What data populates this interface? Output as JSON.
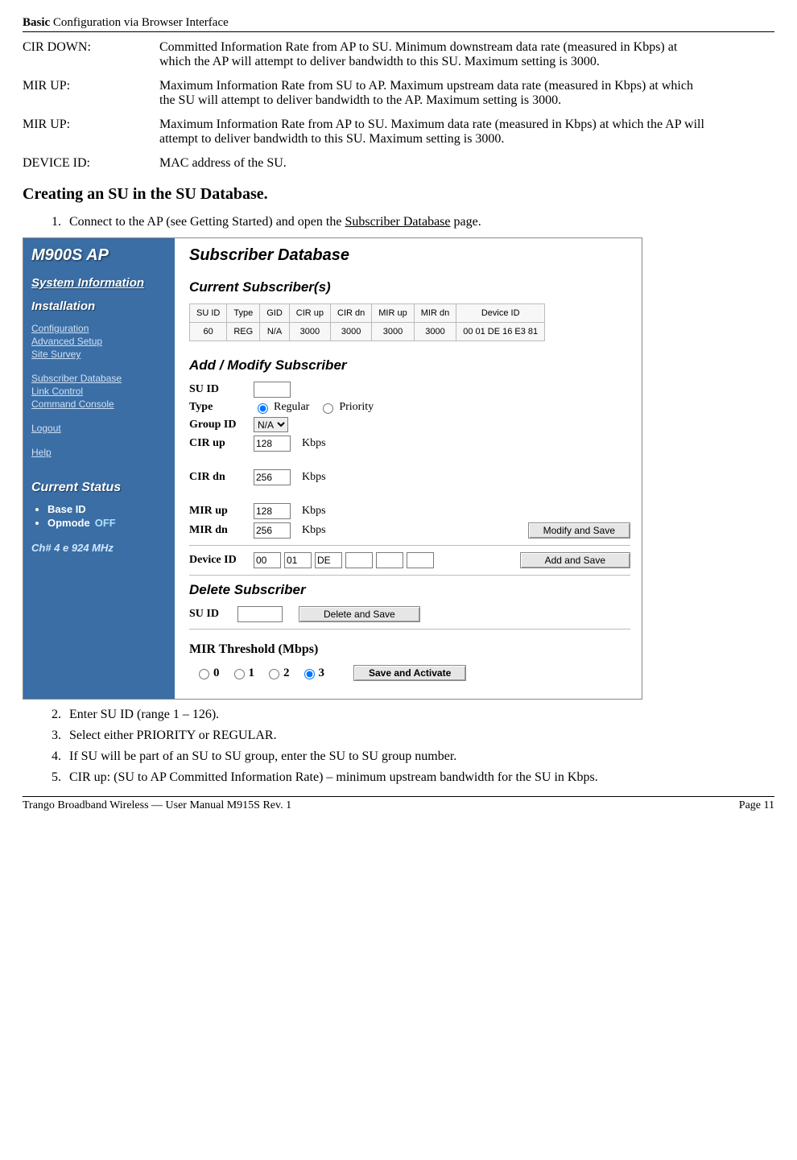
{
  "header": {
    "bold": "Basic",
    "rest": " Configuration via Browser Interface"
  },
  "defs": [
    {
      "term": "CIR DOWN:",
      "desc": "Committed Information Rate from AP to SU.  Minimum downstream data rate (measured in Kbps) at which the AP will attempt to deliver bandwidth to this SU.  Maximum setting is 3000."
    },
    {
      "term": "MIR UP:",
      "desc": "Maximum Information Rate from SU to AP.  Maximum upstream data rate (measured in Kbps) at which the SU will attempt to deliver bandwidth to the AP.  Maximum setting is 3000."
    },
    {
      "term": "MIR UP:",
      "desc": "Maximum Information Rate from AP to SU.  Maximum data rate (measured in Kbps) at which the AP will attempt to deliver bandwidth to this SU.  Maximum setting is 3000."
    },
    {
      "term": "DEVICE ID:",
      "desc": "MAC address of the SU."
    }
  ],
  "section_title": "Creating an SU in the SU Database.",
  "steps_top": [
    "Connect to the AP (see Getting Started) and open the "
  ],
  "step1_link": "Subscriber Database",
  "step1_tail": " page.",
  "sidebar": {
    "brand": "M900S AP",
    "sys_info": "System Information",
    "install": "Installation",
    "links1": [
      "Configuration",
      "Advanced Setup",
      "Site Survey"
    ],
    "links2": [
      "Subscriber Database",
      "Link Control",
      "Command Console"
    ],
    "logout": "Logout",
    "help": "Help",
    "status_title": "Current Status",
    "status_items": [
      {
        "label": "Base ID",
        "extra": ""
      },
      {
        "label": "Opmode",
        "extra": "OFF"
      }
    ],
    "chan": "Ch# 4 e 924 MHz"
  },
  "content": {
    "title": "Subscriber Database",
    "current_title": "Current Subscriber(s)",
    "table": {
      "headers": [
        "SU ID",
        "Type",
        "GID",
        "CIR up",
        "CIR dn",
        "MIR up",
        "MIR dn",
        "Device ID"
      ],
      "row": [
        "60",
        "REG",
        "N/A",
        "3000",
        "3000",
        "3000",
        "3000",
        "00 01 DE 16 E3 81"
      ]
    },
    "addmod_title": "Add / Modify Subscriber",
    "form": {
      "suid_label": "SU ID",
      "suid_value": "",
      "type_label": "Type",
      "type_regular": "Regular",
      "type_priority": "Priority",
      "group_label": "Group ID",
      "group_value": "N/A",
      "cir_up_label": "CIR up",
      "cir_up_value": "128",
      "kbps": "Kbps",
      "cir_dn_label": "CIR dn",
      "cir_dn_value": "256",
      "mir_up_label": "MIR up",
      "mir_up_value": "128",
      "mir_dn_label": "MIR dn",
      "mir_dn_value": "256",
      "modify_btn": "Modify and Save",
      "device_label": "Device ID",
      "device_vals": [
        "00",
        "01",
        "DE",
        "",
        "",
        ""
      ],
      "add_btn": "Add and Save"
    },
    "delete_title": "Delete Subscriber",
    "delete_suid_label": "SU ID",
    "delete_btn": "Delete and Save",
    "mir_title": "MIR Threshold (Mbps)",
    "mir_opts": [
      "0",
      "1",
      "2",
      "3"
    ],
    "mir_selected": "3",
    "save_act_btn": "Save and Activate"
  },
  "steps_bottom": [
    "Enter SU ID (range 1 – 126).",
    "Select either PRIORITY or REGULAR.",
    "If SU will be part of an SU to SU group, enter the SU to SU group number.",
    "CIR up: (SU to AP Committed Information Rate) – minimum upstream bandwidth for the SU in Kbps."
  ],
  "footer": {
    "left": "Trango Broadband Wireless — User Manual M915S Rev. 1",
    "right": "Page 11"
  }
}
